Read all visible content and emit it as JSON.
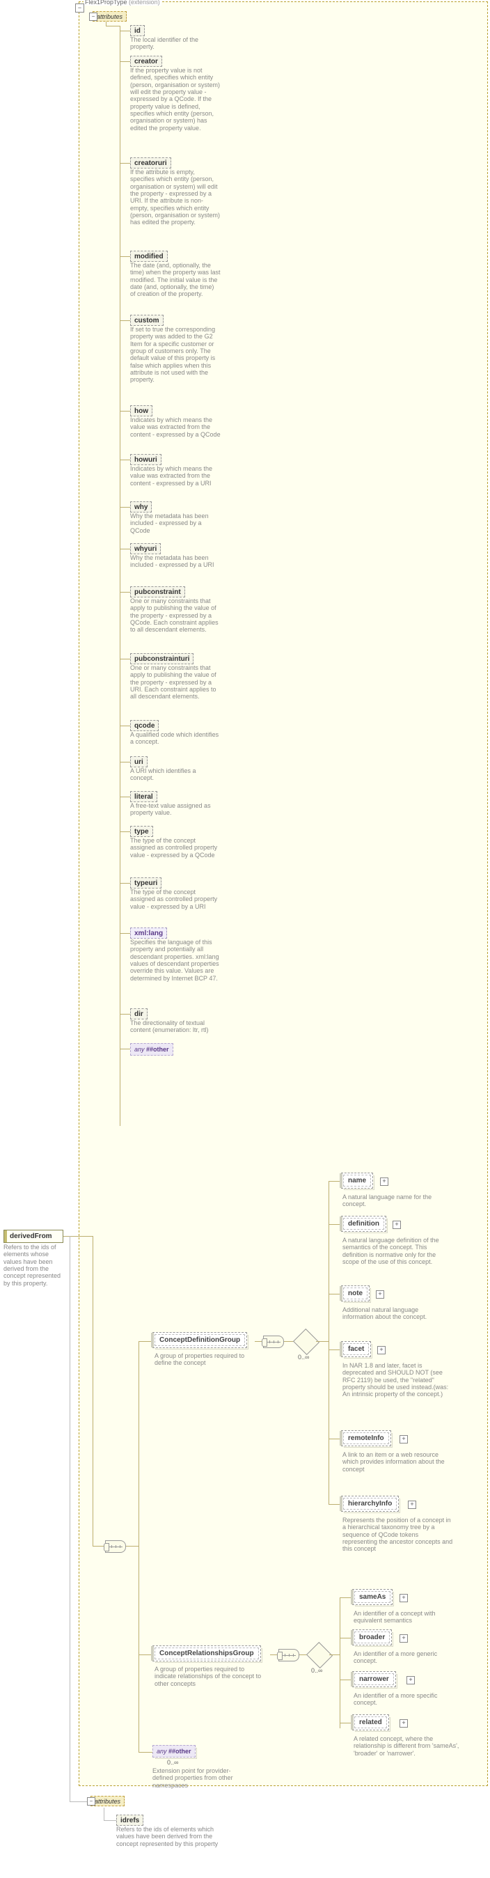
{
  "extension": {
    "type_label": "Flex1PropType",
    "suffix": "(extension)",
    "attributes_label": "attributes"
  },
  "root_element": {
    "name": "derivedFrom",
    "doc": "Refers to the ids of elements whose values have been derived from the concept represented by this property."
  },
  "attrs": [
    {
      "name": "id",
      "doc": "The local identifier of the property."
    },
    {
      "name": "creator",
      "doc": "If the property value is not defined, specifies which entity (person, organisation or system) will edit the property value - expressed by a QCode. If the property value is defined, specifies which entity (person, organisation or system) has edited the property value."
    },
    {
      "name": "creatoruri",
      "doc": "If the attribute is empty, specifies which entity (person, organisation or system) will edit the property - expressed by a URI. If the attribute is non-empty, specifies which entity (person, organisation or system) has edited the property."
    },
    {
      "name": "modified",
      "doc": "The date (and, optionally, the time) when the property was last modified. The initial value is the date (and, optionally, the time) of creation of the property."
    },
    {
      "name": "custom",
      "doc": "If set to true the corresponding property was added to the G2 Item for a specific customer or group of customers only. The default value of this property is false which applies when this attribute is not used with the property."
    },
    {
      "name": "how",
      "doc": "Indicates by which means the value was extracted from the content - expressed by a QCode"
    },
    {
      "name": "howuri",
      "doc": "Indicates by which means the value was extracted from the content - expressed by a URI"
    },
    {
      "name": "why",
      "doc": "Why the metadata has been included - expressed by a QCode"
    },
    {
      "name": "whyuri",
      "doc": "Why the metadata has been included - expressed by a URI"
    },
    {
      "name": "pubconstraint",
      "doc": "One or many constraints that apply to publishing the value of the property - expressed by a QCode. Each constraint applies to all descendant elements."
    },
    {
      "name": "pubconstrainturi",
      "doc": "One or many constraints that apply to publishing the value of the property - expressed by a URI. Each constraint applies to all descendant elements."
    },
    {
      "name": "qcode",
      "doc": "A qualified code which identifies a concept."
    },
    {
      "name": "uri",
      "doc": "A URI which identifies a concept."
    },
    {
      "name": "literal",
      "doc": "A free-text value assigned as property value."
    },
    {
      "name": "type",
      "doc": "The type of the concept assigned as controlled property value - expressed by a QCode"
    },
    {
      "name": "typeuri",
      "doc": "The type of the concept assigned as controlled property value - expressed by a URI"
    },
    {
      "name": "xml:lang",
      "doc": "Specifies the language of this property and potentially all descendant properties. xml:lang values of descendant properties override this value. Values are determined by Internet BCP 47."
    },
    {
      "name": "dir",
      "doc": "The directionality of textual content (enumeration: ltr, rtl)"
    }
  ],
  "wildcard_attr": "##other",
  "groups": {
    "def": {
      "name": "ConceptDefinitionGroup",
      "doc": "A group of properties required to define the concept",
      "occ": "0..∞"
    },
    "rel": {
      "name": "ConceptRelationshipsGroup",
      "doc": "A group of properties required to indicate relationships of the concept to other concepts",
      "occ": "0..∞"
    }
  },
  "def_children": [
    {
      "name": "name",
      "doc": "A natural language name for the concept."
    },
    {
      "name": "definition",
      "doc": "A natural language definition of the semantics of the concept. This definition is normative only for the scope of the use of this concept."
    },
    {
      "name": "note",
      "doc": "Additional natural language information about the concept."
    },
    {
      "name": "facet",
      "doc": "In NAR 1.8 and later, facet is deprecated and SHOULD NOT (see RFC 2119) be used, the \"related\" property should be used instead.(was: An intrinsic property of the concept.)"
    },
    {
      "name": "remoteInfo",
      "doc": "A link to an item or a web resource which provides information about the concept"
    },
    {
      "name": "hierarchyInfo",
      "doc": "Represents the position of a concept in a hierarchical taxonomy tree by a sequence of QCode tokens representing the ancestor concepts and this concept"
    }
  ],
  "rel_children": [
    {
      "name": "sameAs",
      "doc": "An identifier of a concept with equivalent semantics"
    },
    {
      "name": "broader",
      "doc": "An identifier of a more generic concept."
    },
    {
      "name": "narrower",
      "doc": "An identifier of a more specific concept."
    },
    {
      "name": "related",
      "doc": "A related concept, where the relationship is different from 'sameAs', 'broader' or 'narrower'."
    }
  ],
  "any_element": {
    "label": "##other",
    "occ": "0..∞",
    "doc": "Extension point for provider-defined properties from other namespaces"
  },
  "bottom_attrs": {
    "label": "attributes",
    "attr": {
      "name": "idrefs",
      "doc": "Refers to the ids of elements which values have been derived from the concept represented by this property"
    }
  },
  "any_prefix": "any"
}
